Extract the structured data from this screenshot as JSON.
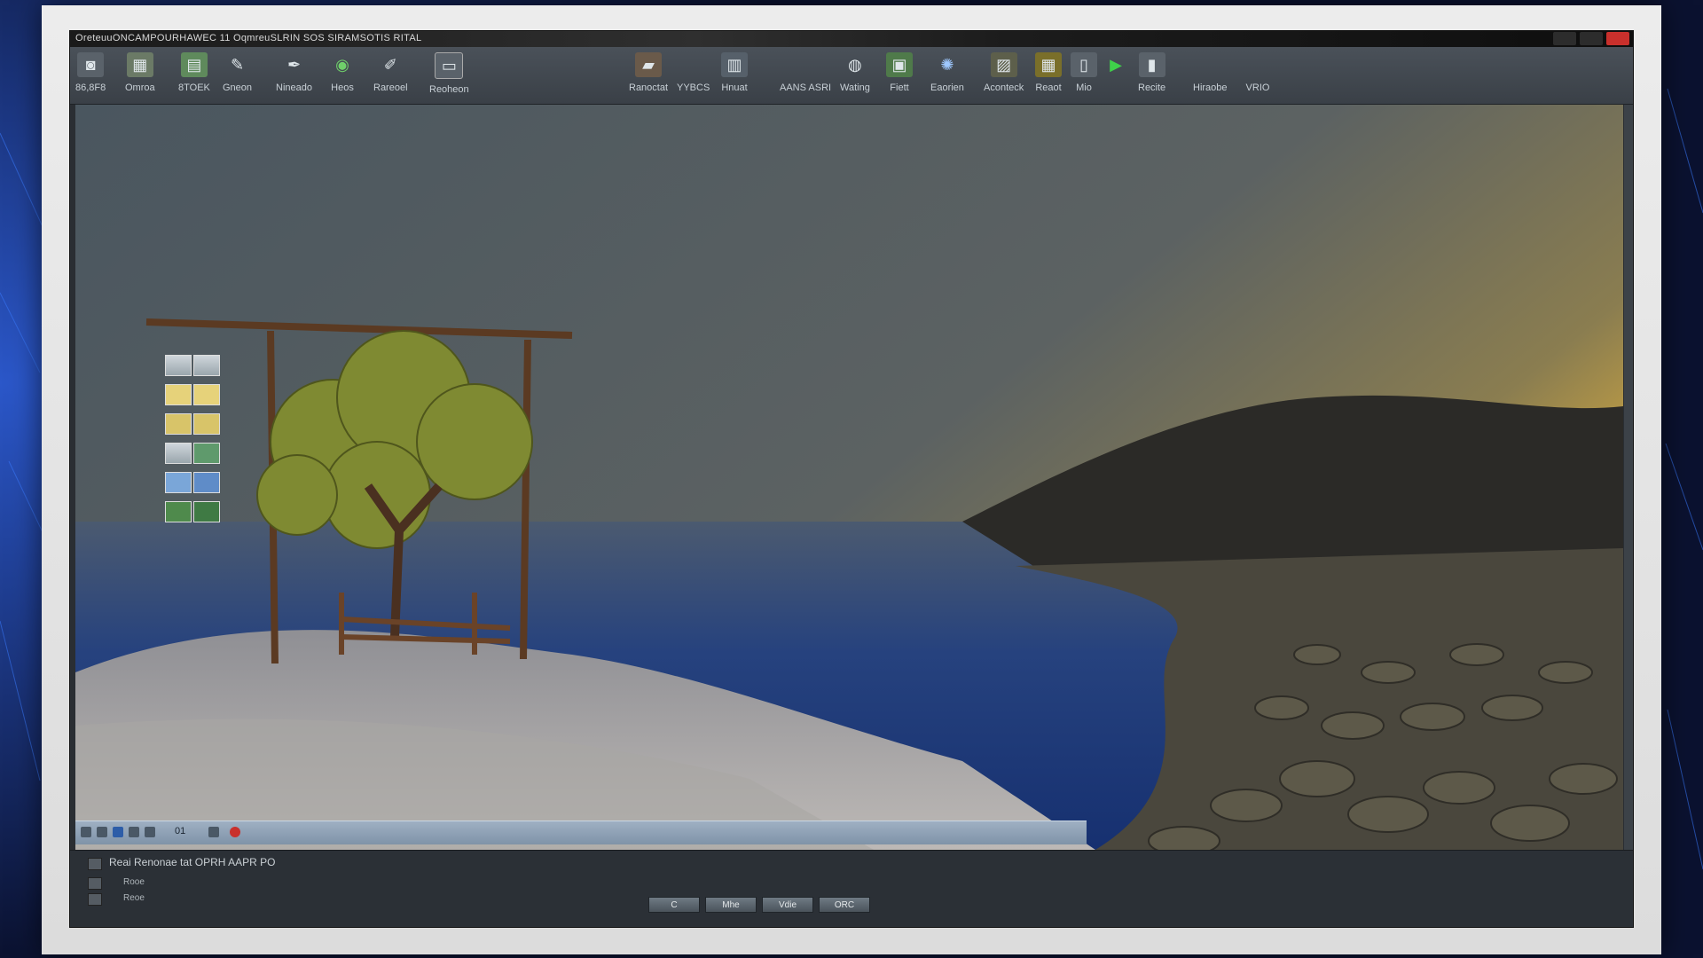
{
  "window": {
    "title": "OreteuuONCAMPOURHAWEC 11 OqmreuSLRIN SOS SIRAMSOTIS RITAL",
    "controls": [
      "minimize-button",
      "restore-button",
      "close-button"
    ]
  },
  "toolbar": {
    "items": [
      {
        "label": "86,8F8",
        "icon": "camera-icon"
      },
      {
        "label": "Omroa",
        "icon": "grid-icon"
      },
      {
        "label": "8TOEK",
        "icon": "layers-icon"
      },
      {
        "label": "Gneon",
        "icon": "brush-icon"
      },
      {
        "label": "Nineado",
        "icon": "pen-icon"
      },
      {
        "label": "Heos",
        "icon": "circle-icon"
      },
      {
        "label": "Rareoel",
        "icon": "pencil-icon"
      },
      {
        "label": "Reoheon",
        "icon": "monitor-icon"
      },
      {
        "label": "Ranoctat",
        "icon": "folder-icon"
      },
      {
        "label": "YYBCS",
        "icon": "label-icon"
      },
      {
        "label": "Hnuat",
        "icon": "panel-icon"
      },
      {
        "label": "AANS ASRI",
        "icon": "text-icon"
      },
      {
        "label": "Wating",
        "icon": "globe-icon"
      },
      {
        "label": "Fiett",
        "icon": "map-icon"
      },
      {
        "label": "Eaorien",
        "icon": "sparkle-icon"
      },
      {
        "label": "Aconteck",
        "icon": "image-icon"
      },
      {
        "label": "Reaot",
        "icon": "chart-icon"
      },
      {
        "label": "Mio",
        "icon": "film-icon"
      },
      {
        "label": "",
        "icon": "play-icon"
      },
      {
        "label": "Recite",
        "icon": "device-icon"
      },
      {
        "label": "Hiraobe",
        "icon": ""
      },
      {
        "label": "VRIO",
        "icon": ""
      }
    ]
  },
  "bottom_strip": {
    "text": "01"
  },
  "panel": {
    "header": "Reai Renonae tat OPRH AAPR PO",
    "rows": [
      "Rooe",
      "Reoe"
    ],
    "buttons": [
      "C",
      "Mhe",
      "Vdie",
      "ORC"
    ]
  },
  "colors": {
    "frame": "#e3e3e3",
    "toolbar": "#434a51",
    "sky_top": "#4f5a63",
    "sun_glow": "#e8b43a",
    "water": "#1e3a7a"
  }
}
